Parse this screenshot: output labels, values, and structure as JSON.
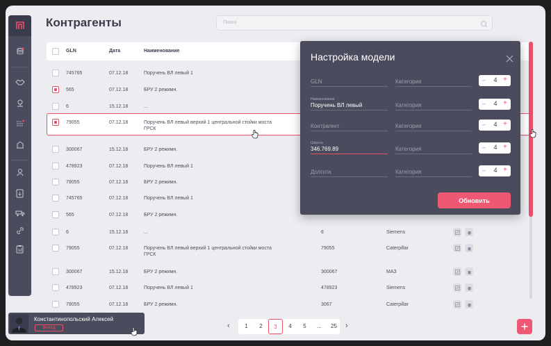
{
  "page": {
    "title": "Контрагенты"
  },
  "search": {
    "placeholder": "Поиск"
  },
  "table": {
    "headers": {
      "gln": "GLN",
      "date": "Дата",
      "name": "Наименование"
    },
    "rows": [
      {
        "gln": "745765",
        "date": "07.12.18",
        "name": "Поручень ВЛ левый 1",
        "c4": "",
        "c5": "",
        "checked": false
      },
      {
        "gln": "565",
        "date": "07.12.18",
        "name": "БРУ 2 режимн.",
        "c4": "",
        "c5": "",
        "checked": true
      },
      {
        "gln": "6",
        "date": "15.12.18",
        "name": "...",
        "c4": "",
        "c5": "",
        "checked": false
      },
      {
        "gln": "79055",
        "date": "07.12.18",
        "name": "Поручень ВЛ левый верхий 1 центральной стойки моста ГРСК",
        "c4": "",
        "c5": "",
        "checked": true
      },
      {
        "gln": "300067",
        "date": "15.12.18",
        "name": "БРУ 2 режимн.",
        "c4": "",
        "c5": "",
        "checked": false
      },
      {
        "gln": "478923",
        "date": "07.12.18",
        "name": "Поручень ВЛ левый 1",
        "c4": "",
        "c5": "",
        "checked": false
      },
      {
        "gln": "79055",
        "date": "07.12.18",
        "name": "БРУ 2 режимн.",
        "c4": "",
        "c5": "",
        "checked": false
      },
      {
        "gln": "745765",
        "date": "07.12.18",
        "name": "Поручень ВЛ левый 1",
        "c4": "",
        "c5": "",
        "checked": false
      },
      {
        "gln": "565",
        "date": "07.12.18",
        "name": "БРУ 2 режимн.",
        "c4": "",
        "c5": "",
        "checked": false
      },
      {
        "gln": "6",
        "date": "15.12.18",
        "name": "...",
        "c4": "6",
        "c5": "Siemens",
        "checked": false
      },
      {
        "gln": "79055",
        "date": "07.12.18",
        "name": "Поручень ВЛ левый верхий 1 центральной стойки моста ГРСК",
        "c4": "79055",
        "c5": "Caterpillar",
        "checked": false
      },
      {
        "gln": "300067",
        "date": "15.12.18",
        "name": "БРУ 2 режимн.",
        "c4": "300067",
        "c5": "МАЗ",
        "checked": false
      },
      {
        "gln": "478923",
        "date": "07.12.18",
        "name": "Поручень ВЛ левый 1",
        "c4": "478923",
        "c5": "Siemens",
        "checked": false
      },
      {
        "gln": "79055",
        "date": "07.12.18",
        "name": "БРУ 2 режимн.",
        "c4": "3067",
        "c5": "Caterpillar",
        "checked": false
      }
    ]
  },
  "modal": {
    "title": "Настройка модели",
    "button": "Обновить",
    "fields": [
      {
        "small": "",
        "value": "",
        "placeholder": "GLN",
        "category": "Категория",
        "step": "4"
      },
      {
        "small": "Наименование",
        "value": "Поручень ВЛ левый",
        "placeholder": "",
        "category": "Категория",
        "step": "4"
      },
      {
        "small": "",
        "value": "",
        "placeholder": "Контрагент",
        "category": "Категория",
        "step": "4"
      },
      {
        "small": "Широта",
        "value": "346.769.89",
        "placeholder": "",
        "category": "Категория",
        "step": "4"
      },
      {
        "small": "",
        "value": "",
        "placeholder": "Долгота",
        "category": "Категория",
        "step": "4"
      }
    ]
  },
  "user": {
    "name": "Константинопольский Алексей",
    "logout": "Выход"
  },
  "pagination": {
    "pages": [
      "1",
      "2",
      "3",
      "4",
      "5",
      "...",
      "25"
    ],
    "current": "3",
    "prev": "‹",
    "next": "›"
  },
  "colors": {
    "accent": "#e9506a",
    "dark": "#4a4b5c",
    "bg": "#ededf1"
  },
  "icons": {
    "sidebar": [
      "logo-icon",
      "database-icon",
      "handshake-icon",
      "location-icon",
      "list-icon",
      "warehouse-icon",
      "engineer-icon",
      "document-icon",
      "truck-icon",
      "link-icon",
      "clipboard-icon"
    ]
  }
}
